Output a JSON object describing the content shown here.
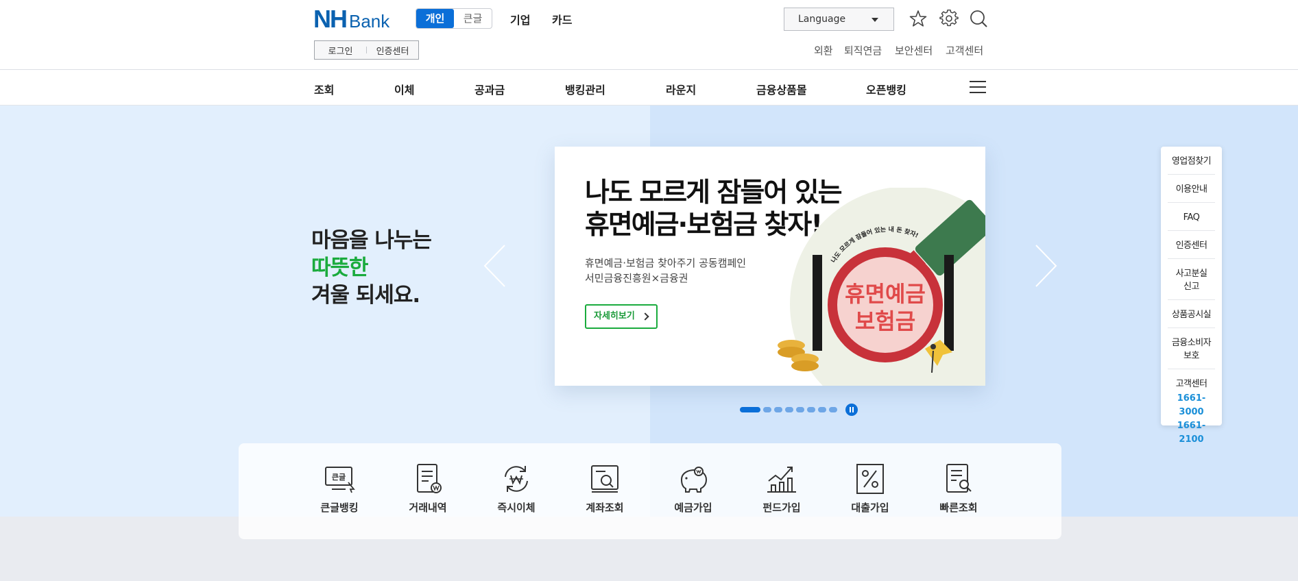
{
  "header": {
    "logo_nh": "NH",
    "logo_bank": "Bank",
    "mode_tabs": [
      "개인",
      "큰글"
    ],
    "top_menu": [
      "기업",
      "카드"
    ],
    "language": "Language",
    "login": "로그인",
    "cert_center": "인증센터",
    "util_links": [
      "외환",
      "퇴직연금",
      "보안센터",
      "고객센터"
    ]
  },
  "gnb": {
    "items": [
      "조회",
      "이체",
      "공과금",
      "뱅킹관리",
      "라운지",
      "금융상품몰",
      "오픈뱅킹"
    ]
  },
  "hero": {
    "slogan_line1": "마음을 나누는",
    "slogan_line2": "따뜻한",
    "slogan_line3": "겨울 되세요.",
    "card_title_line1": "나도 모르게 잠들어 있는",
    "card_title_line2": "휴면예금·보험금 찾자!",
    "card_sub_line1": "휴면예금·보험금 찾아주기 공동캠페인",
    "card_sub_line2": "서민금융진흥원×금융권",
    "card_button": "자세히보기",
    "stamp_top": "나도 모르게 잠들어 있는 내 돈 찾자!",
    "stamp_line1": "휴면예금",
    "stamp_line2": "보험금",
    "slide_count": 8,
    "active_slide": 1
  },
  "side_menu": {
    "items": [
      "영업점찾기",
      "이용안내",
      "FAQ",
      "인증센터",
      "사고분실\n신고",
      "상품공시실",
      "금융소비자\n보호",
      "고객센터"
    ],
    "phones": [
      "1661-3000",
      "1661-2100"
    ]
  },
  "quick_menu": {
    "items": [
      "큰글뱅킹",
      "거래내역",
      "즉시이체",
      "계좌조회",
      "예금가입",
      "펀드가입",
      "대출가입",
      "빠른조회"
    ],
    "icon_text_bigtext": "큰글"
  },
  "colors": {
    "brand_blue": "#0b62b0",
    "accent_blue": "#0b6fd8",
    "green": "#1aab3d",
    "phone_blue": "#1a8fd8"
  },
  "icons": [
    "star-icon",
    "gear-icon",
    "search-icon",
    "hamburger-icon",
    "chevron-left-icon",
    "chevron-right-icon",
    "pause-icon"
  ]
}
